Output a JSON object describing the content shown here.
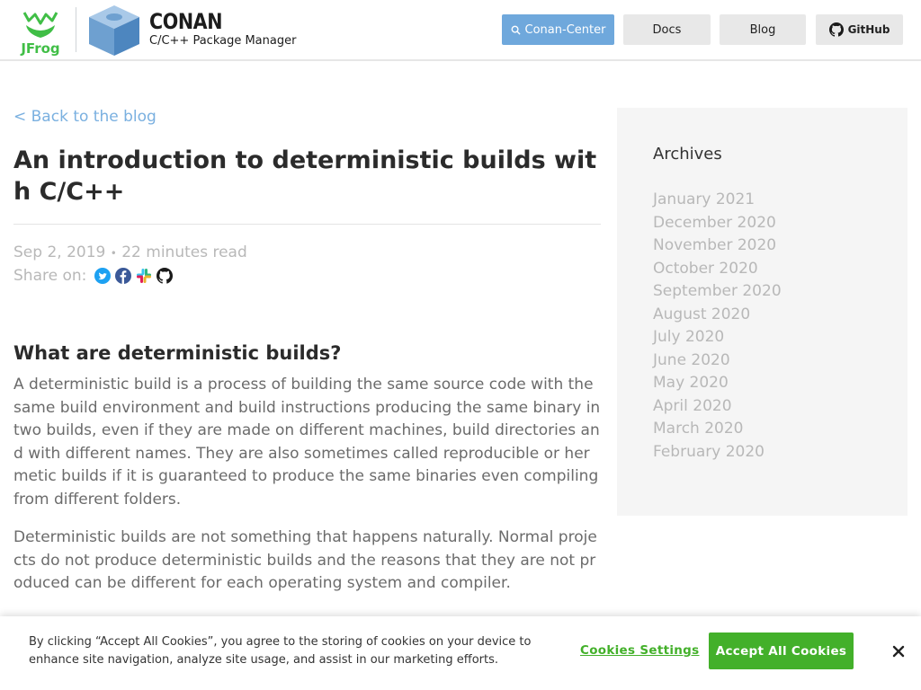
{
  "header": {
    "company_logo": "JFrog",
    "brand_name": "CONAN",
    "brand_tagline": "C/C++ Package Manager",
    "nav": {
      "conan_center": "Conan-Center",
      "docs": "Docs",
      "blog": "Blog",
      "github": "GitHub"
    }
  },
  "article": {
    "back_link": "< Back to the blog",
    "title": "An introduction to deterministic builds with C/C++",
    "date": "Sep 2, 2019",
    "separator": "•",
    "read_time": "22 minutes read",
    "share_label": "Share on:",
    "share_icons": [
      "twitter-icon",
      "facebook-icon",
      "slack-icon",
      "github-icon"
    ],
    "section_heading": "What are deterministic builds?",
    "paragraphs": [
      "A deterministic build is a process of building the same source code with the same build environment and build instructions producing the same binary in two builds, even if they are made on different machines, build directories and with different names. They are also sometimes called reproducible or hermetic builds if it is guaranteed to produce the same binaries even compiling from different folders.",
      "Deterministic builds are not something that happens naturally. Normal projects do not produce deterministic builds and the reasons that they are not produced can be different for each operating system and compiler."
    ]
  },
  "sidebar": {
    "title": "Archives",
    "months": [
      "January 2021",
      "December 2020",
      "November 2020",
      "October 2020",
      "September 2020",
      "August 2020",
      "July 2020",
      "June 2020",
      "May 2020",
      "April 2020",
      "March 2020",
      "February 2020"
    ]
  },
  "cookie_banner": {
    "text": "By clicking “Accept All Cookies”, you agree to the storing of cookies on your device to enhance site navigation, analyze site usage, and assist in our marketing efforts.",
    "settings_label": "Cookies Settings",
    "accept_label": "Accept All Cookies"
  },
  "colors": {
    "accent_blue": "#6fa8dc",
    "link_blue": "#7ab0e0",
    "cookie_green": "#43b02a",
    "jfrog_green": "#40be46",
    "muted_text": "#b8b8b8"
  }
}
